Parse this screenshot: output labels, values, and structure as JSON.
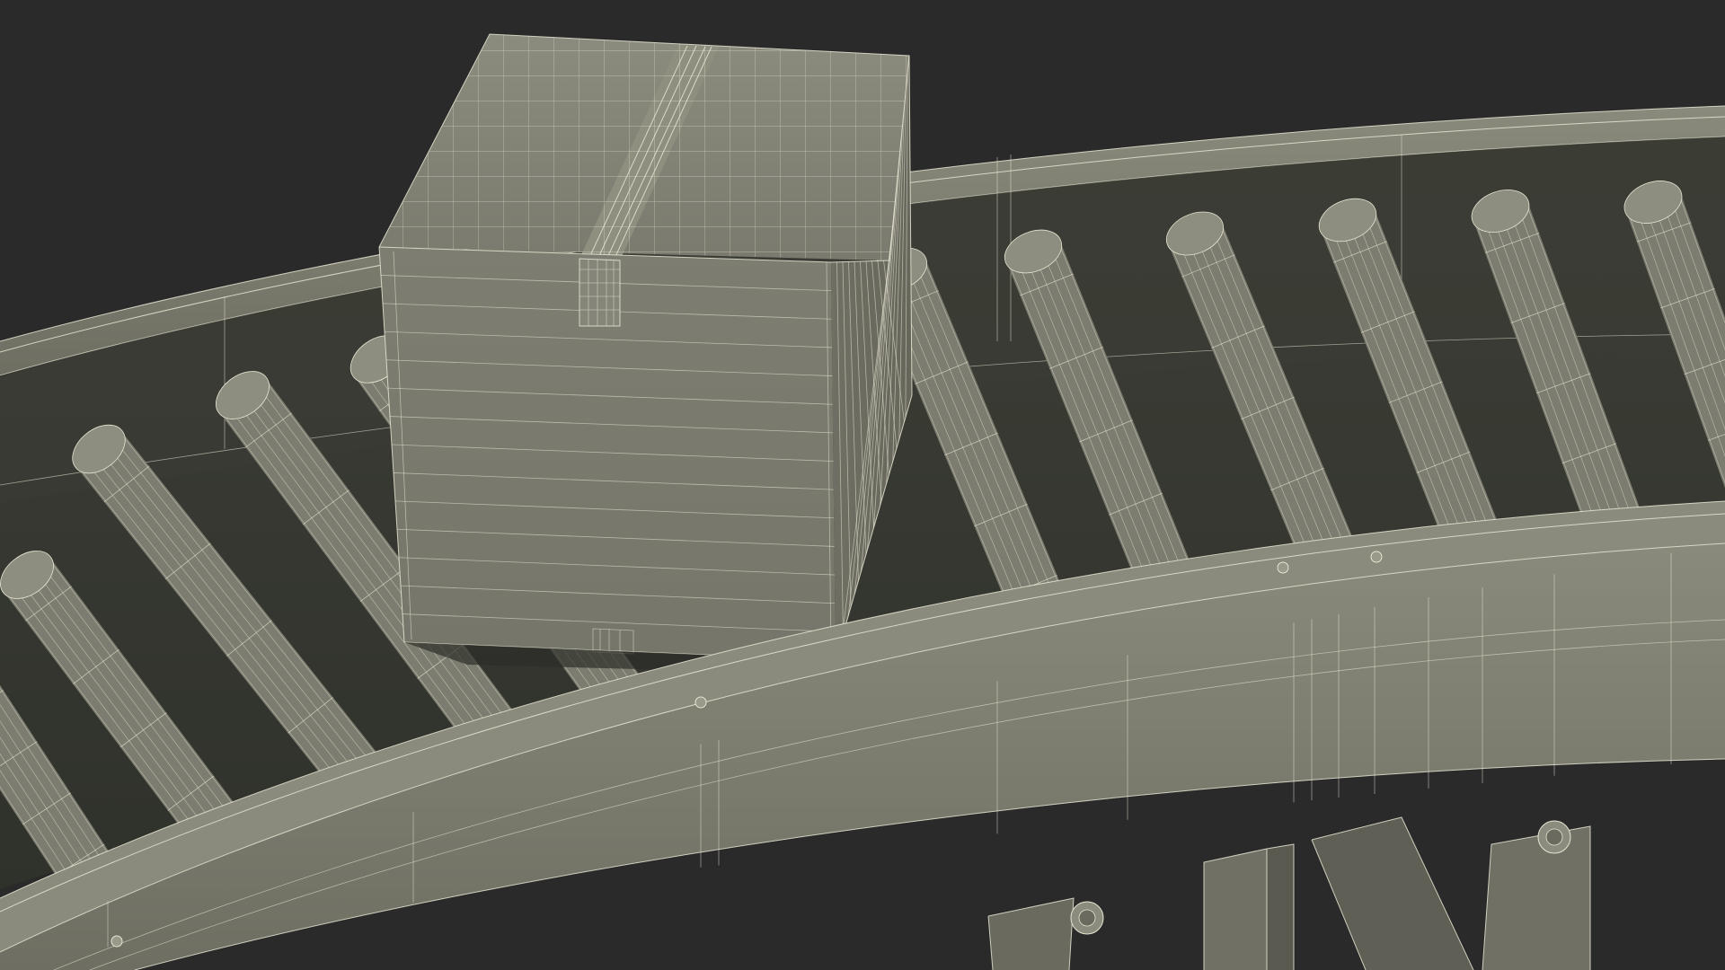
{
  "scene": {
    "background_color": "#2a2a2a",
    "surface_color": "#7a7a6e",
    "surface_shadow_color": "#3f413a",
    "wire_color": "#e7e5d2",
    "objects": [
      "cardboard-box-icon",
      "roller-conveyor-curved-icon",
      "conveyor-support-legs-icon"
    ]
  }
}
